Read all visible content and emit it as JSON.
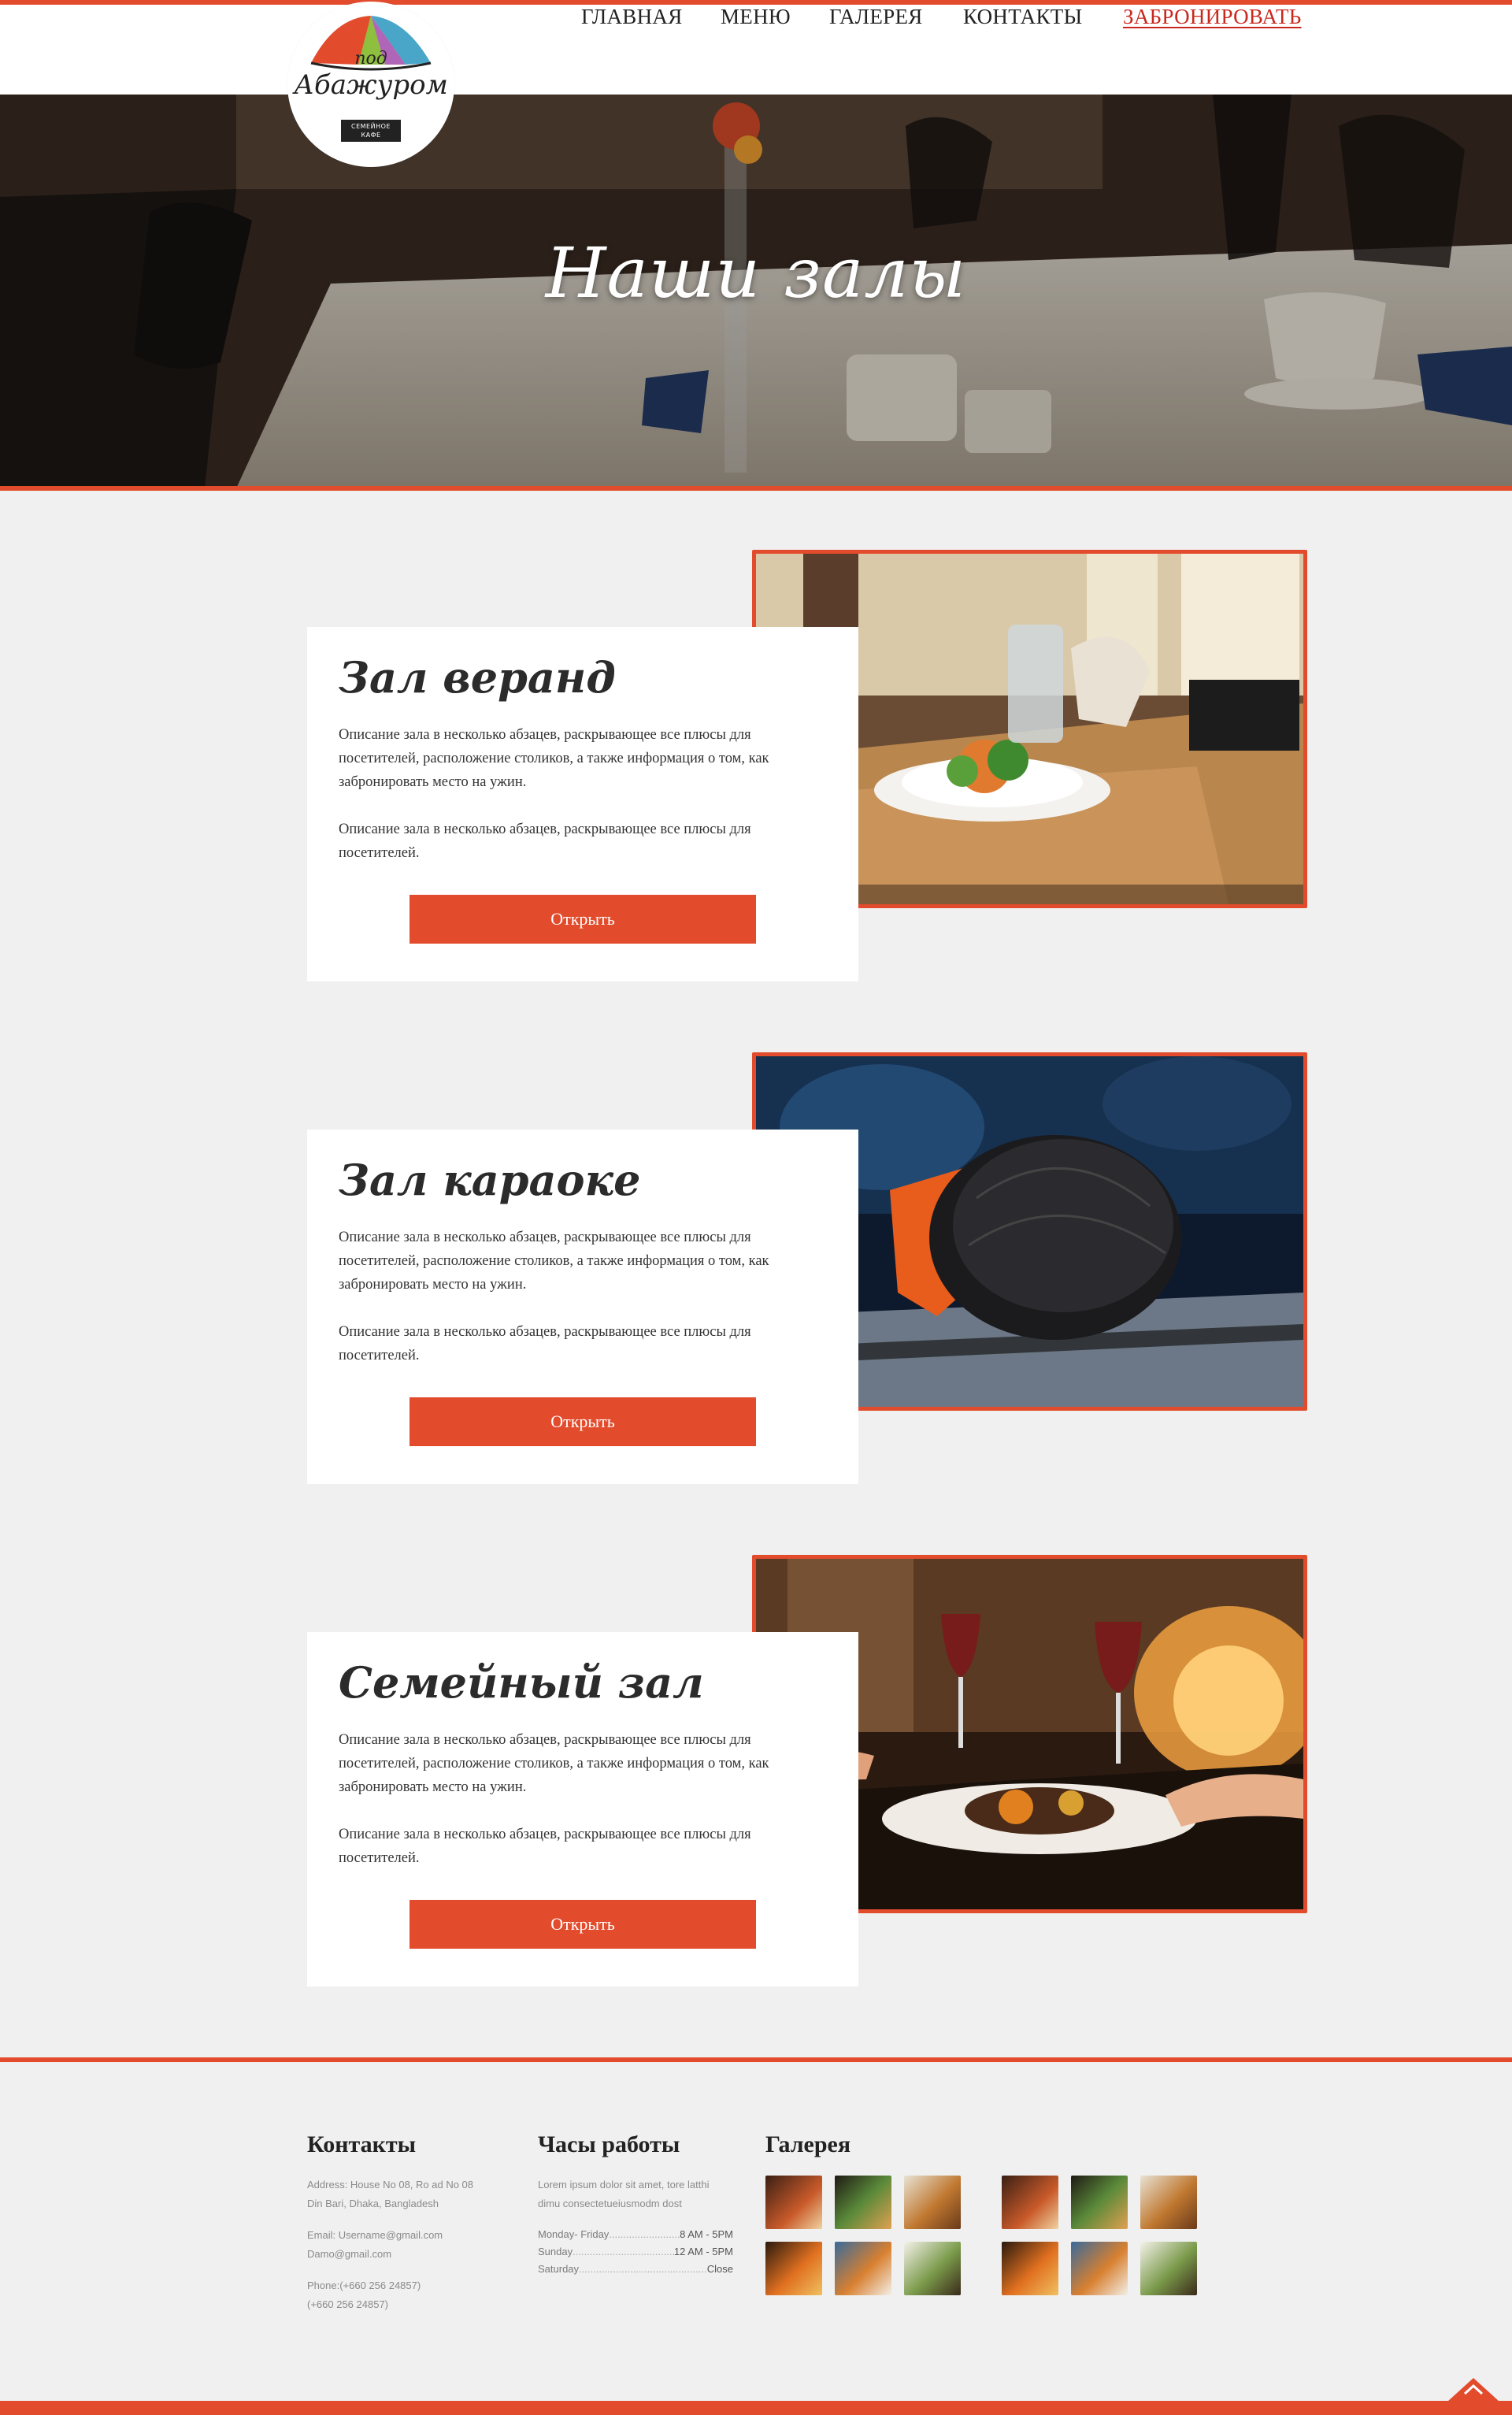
{
  "logo": {
    "line1": "под",
    "line2": "Абажуром",
    "sub1": "СЕМЕЙНОЕ",
    "sub2": "КАФЕ"
  },
  "nav": {
    "home": "ГЛАВНАЯ",
    "menu": "МЕНЮ",
    "gallery": "ГАЛЕРЕЯ",
    "contacts": "КОНТАКТЫ",
    "book": "ЗАБРОНИРОВАТЬ"
  },
  "hero": {
    "title": "Наши залы"
  },
  "halls": [
    {
      "title": "Зал веранд",
      "p1": "Описание зала в несколько абзацев, раскрывающее все плюсы для посетителей, расположение столиков, а также информация о том, как забронировать место на ужин.",
      "p2": "Описание зала в несколько абзацев, раскрывающее все плюсы для посетителей.",
      "button": "Открыть"
    },
    {
      "title": "Зал караоке",
      "p1": "Описание зала в несколько абзацев, раскрывающее все плюсы для посетителей, расположение столиков, а также информация о том, как забронировать место на ужин.",
      "p2": "Описание зала в несколько абзацев, раскрывающее все плюсы для посетителей.",
      "button": "Открыть"
    },
    {
      "title": "Семейный зал",
      "p1": "Описание зала в несколько абзацев, раскрывающее все плюсы для посетителей, расположение столиков, а также информация о том, как забронировать место на ужин.",
      "p2": "Описание зала в несколько абзацев, раскрывающее все плюсы для посетителей.",
      "button": "Открыть"
    }
  ],
  "footer": {
    "contacts": {
      "title": "Контакты",
      "address1": "Address: House No 08, Ro ad No 08",
      "address2": "Din Bari, Dhaka, Bangladesh",
      "email1": "Email: Username@gmail.com",
      "email2": "Damo@gmail.com",
      "phone1": "Phone:(+660 256 24857)",
      "phone2": "(+660 256 24857)"
    },
    "hours": {
      "title": "Часы работы",
      "intro1": "Lorem ipsum dolor sit amet, tore latthi",
      "intro2": "dimu consectetueiusmodm dost",
      "rows": [
        {
          "day": "Monday- Friday",
          "time": "8 AM - 5PM"
        },
        {
          "day": "Sunday",
          "time": "12 AM - 5PM"
        },
        {
          "day": "Saturday",
          "time": "Close"
        }
      ]
    },
    "gallery": {
      "title": "Галерея"
    }
  },
  "colors": {
    "accent": "#e24c2d",
    "page_bg": "#f0f0f0",
    "card_bg": "#ffffff"
  },
  "icons": {
    "scroll_top": "chevron-up-icon"
  }
}
